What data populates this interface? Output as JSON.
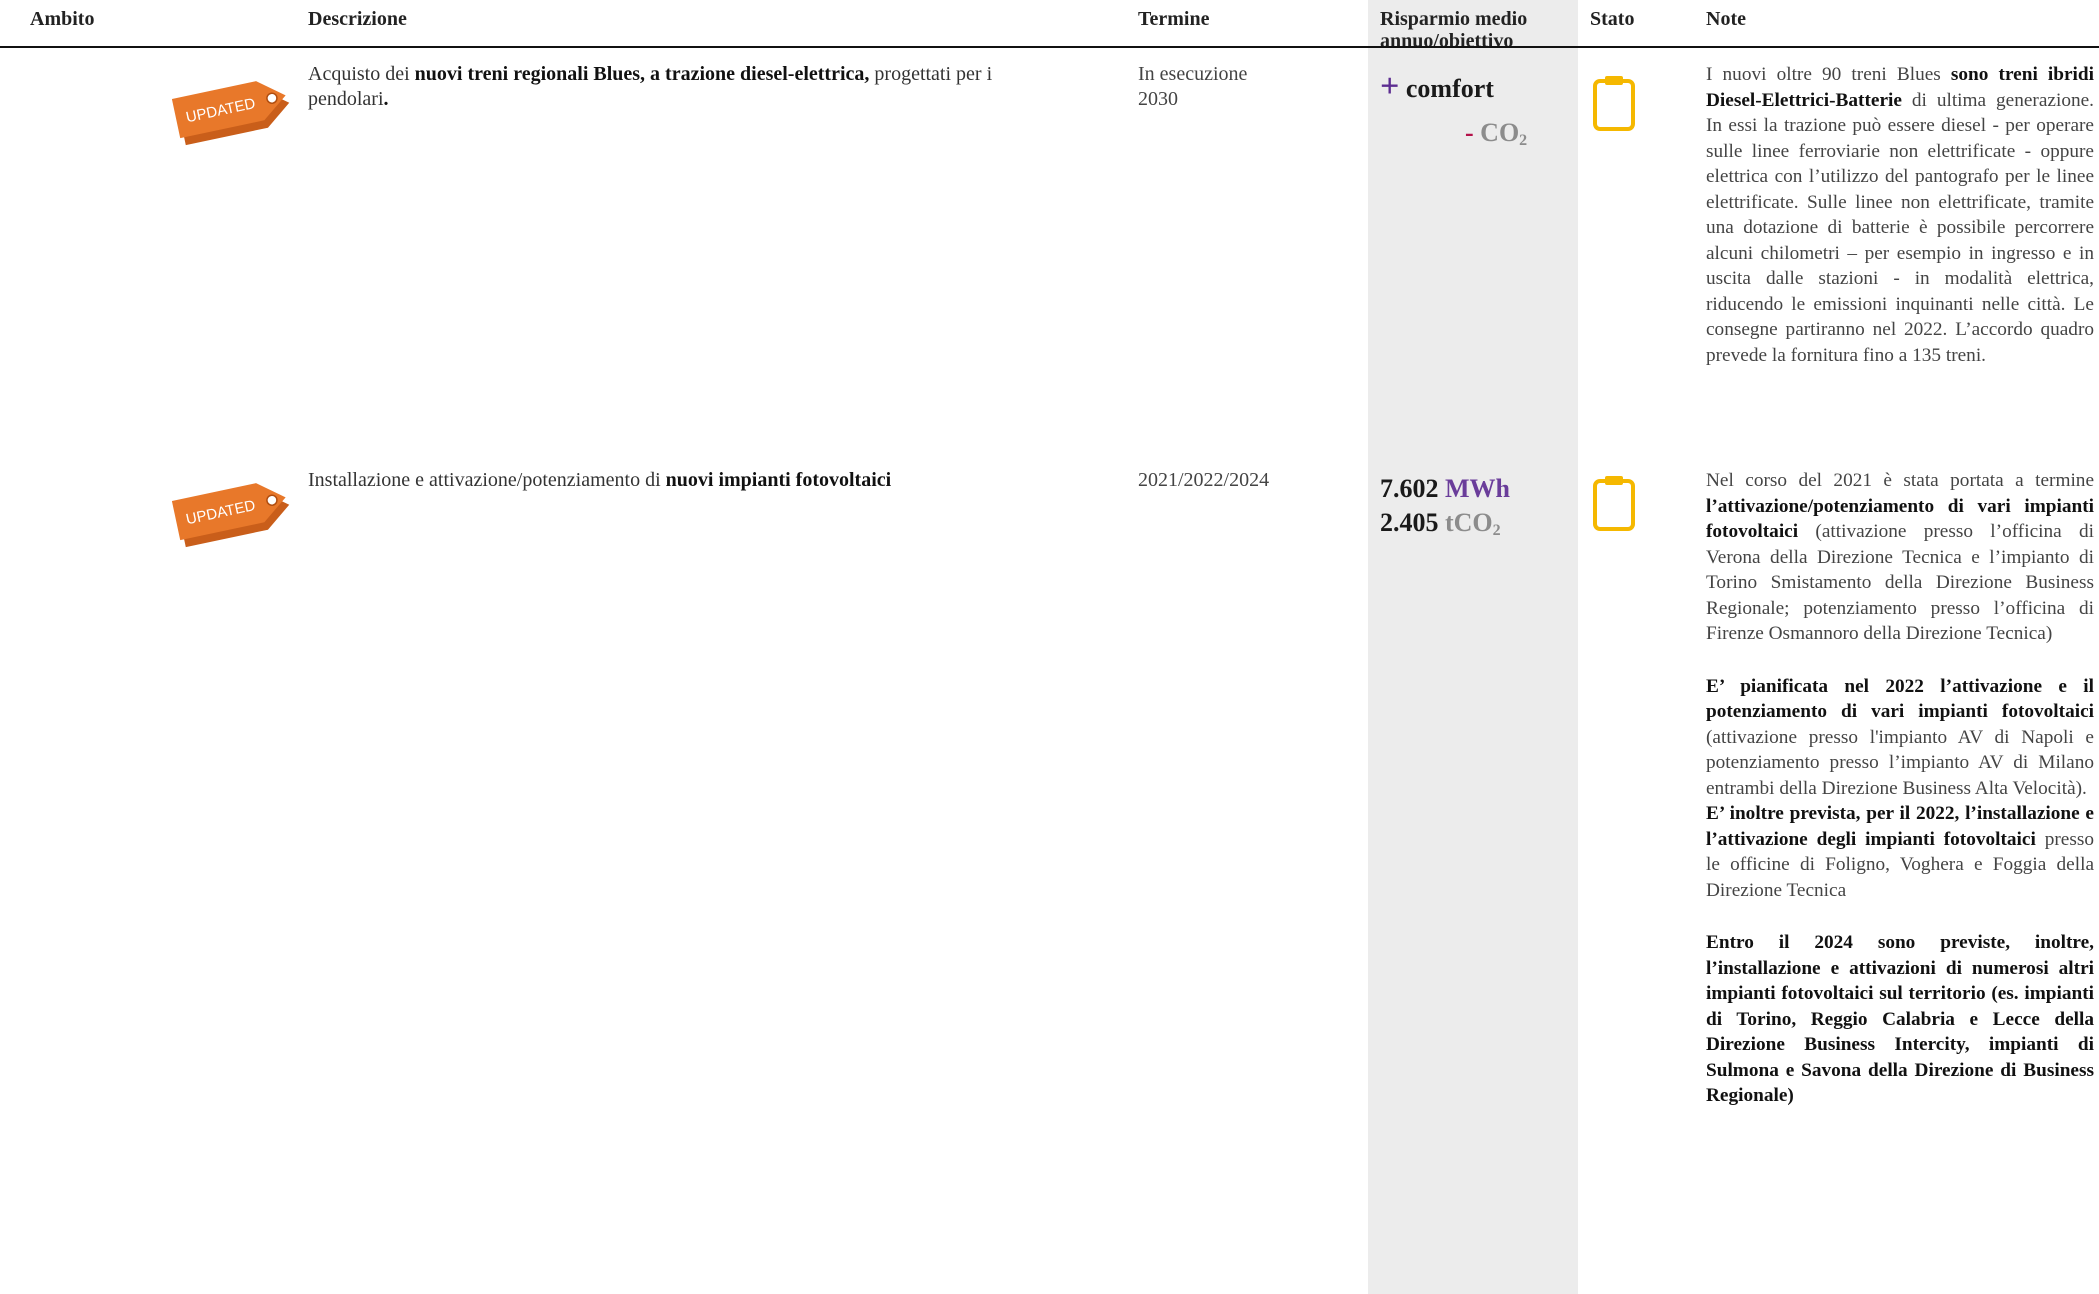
{
  "header": {
    "ambito": "Ambito",
    "descrizione": "Descrizione",
    "termine": "Termine",
    "risparmio_line1": "Risparmio medio",
    "risparmio_line2": "annuo/obiettivo",
    "stato": "Stato",
    "note": "Note"
  },
  "rows": [
    {
      "badge": "UPDATED",
      "desc_pre": "Acquisto dei ",
      "desc_bold": "nuovi treni regionali Blues, a trazione diesel-elettrica,",
      "desc_post": " progettati per i",
      "desc_line2": "pendolari",
      "desc_line2_end": ".",
      "termine_1": "In esecuzione",
      "termine_2": "2030",
      "risp_plus": "+",
      "risp_comfort": "comfort",
      "risp_minus": "-",
      "risp_co": "CO",
      "risp_co_sub": "2",
      "stato_icon": "clipboard-icon",
      "note_pre": "I nuovi oltre 90 treni Blues ",
      "note_bold": "sono treni ibridi Diesel-Elettrici-Batterie",
      "note_post": " di ultima generazione. In essi la trazione può essere diesel - per operare sulle linee ferroviarie non elettrificate - oppure elettrica con l’utilizzo del pantografo per le linee elettrificate. Sulle linee non elettrificate, tramite una dotazione di batterie è possibile percorrere alcuni chilometri – per esempio in ingresso e in uscita dalle stazioni - in modalità elettrica, riducendo le emissioni inquinanti nelle città. Le consegne partiranno nel 2022. L’accordo quadro prevede la fornitura fino a 135 treni."
    },
    {
      "badge": "UPDATED",
      "desc_pre": "Installazione e attivazione/potenziamento di ",
      "desc_bold": "nuovi impianti fotovoltaici",
      "termine_1": "2021/2022/2024",
      "risp_val1": "7.602",
      "risp_unit1": "MWh",
      "risp_val2": "2.405",
      "risp_unit2": "tCO",
      "risp_unit2_sub": "2",
      "stato_icon": "clipboard-icon",
      "note1_pre": "Nel corso del 2021 è stata portata a termine ",
      "note1_bold": "l’attivazione/potenziamento di vari impianti fotovoltaici",
      "note1_post": " (attivazione presso l’officina di Verona della Direzione Tecnica e l’impianto di Torino Smistamento della Direzione Business Regionale; potenziamento presso l’officina di Firenze Osmannoro della Direzione Tecnica)",
      "note2_bold": "E’ pianificata nel 2022 l’attivazione e il potenziamento di vari impianti fotovoltaici",
      "note2_post": " (attivazione presso l'impianto AV di Napoli e potenziamento presso l’impianto AV di Milano entrambi della Direzione Business Alta Velocità).",
      "note3_bold": "E’ inoltre prevista, per il 2022, l’installazione e l’attivazione degli impianti fotovoltaici",
      "note3_post": " presso le officine di Foligno, Voghera e Foggia della Direzione Tecnica",
      "note4_bold": "Entro il 2024 sono previste, inoltre, l’installazione e attivazioni di numerosi altri impianti fotovoltaici sul territorio (es. impianti di Torino, Reggio Calabria e Lecce della Direzione Business Intercity, impianti di Sulmona e Savona della Direzione di Business Regionale)"
    }
  ],
  "colors": {
    "tag_orange": "#e8782a",
    "clipboard_yellow": "#f5b800",
    "value_purple": "#6a3d9a",
    "header_gray_column": "#ececec"
  }
}
